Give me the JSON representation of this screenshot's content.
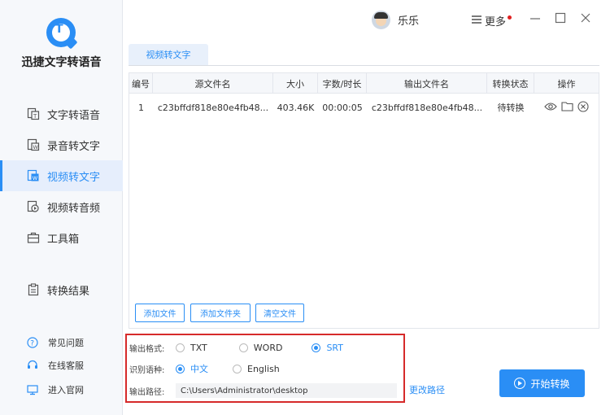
{
  "app": {
    "name": "迅捷文字转语音"
  },
  "sidebar": {
    "items": [
      {
        "label": "文字转语音",
        "icon": "text-to-speech-icon"
      },
      {
        "label": "录音转文字",
        "icon": "recording-to-text-icon"
      },
      {
        "label": "视频转文字",
        "icon": "video-to-text-icon",
        "active": true
      },
      {
        "label": "视频转音频",
        "icon": "video-to-audio-icon"
      },
      {
        "label": "工具箱",
        "icon": "toolbox-icon"
      },
      {
        "label": "转换结果",
        "icon": "results-icon"
      }
    ],
    "help": [
      {
        "label": "常见问题",
        "icon": "question-icon"
      },
      {
        "label": "在线客服",
        "icon": "headset-icon"
      },
      {
        "label": "进入官网",
        "icon": "monitor-icon"
      }
    ]
  },
  "header": {
    "username": "乐乐",
    "more_label": "更多"
  },
  "tab": {
    "label": "视频转文字"
  },
  "table": {
    "columns": [
      "编号",
      "源文件名",
      "大小",
      "字数/时长",
      "输出文件名",
      "转换状态",
      "操作"
    ],
    "rows": [
      {
        "id": "1",
        "source": "c23bffdf818e80e4fb48...",
        "size": "403.46K",
        "duration": "00:00:05",
        "output": "c23bffdf818e80e4fb48...",
        "status": "待转换"
      }
    ]
  },
  "buttons": {
    "add_file": "添加文件",
    "add_folder": "添加文件夹",
    "clear_files": "清空文件"
  },
  "settings": {
    "format_label": "输出格式:",
    "formats": [
      "TXT",
      "WORD",
      "SRT"
    ],
    "selected_format": "SRT",
    "language_label": "识别语种:",
    "languages": [
      "中文",
      "English"
    ],
    "selected_language": "中文",
    "path_label": "输出路径:",
    "path_value": "C:\\Users\\Administrator\\desktop"
  },
  "change_dir_label": "更改路径",
  "start_label": "开始转换",
  "colors": {
    "accent": "#2a8ef5",
    "highlight_border": "#d62a2a"
  }
}
